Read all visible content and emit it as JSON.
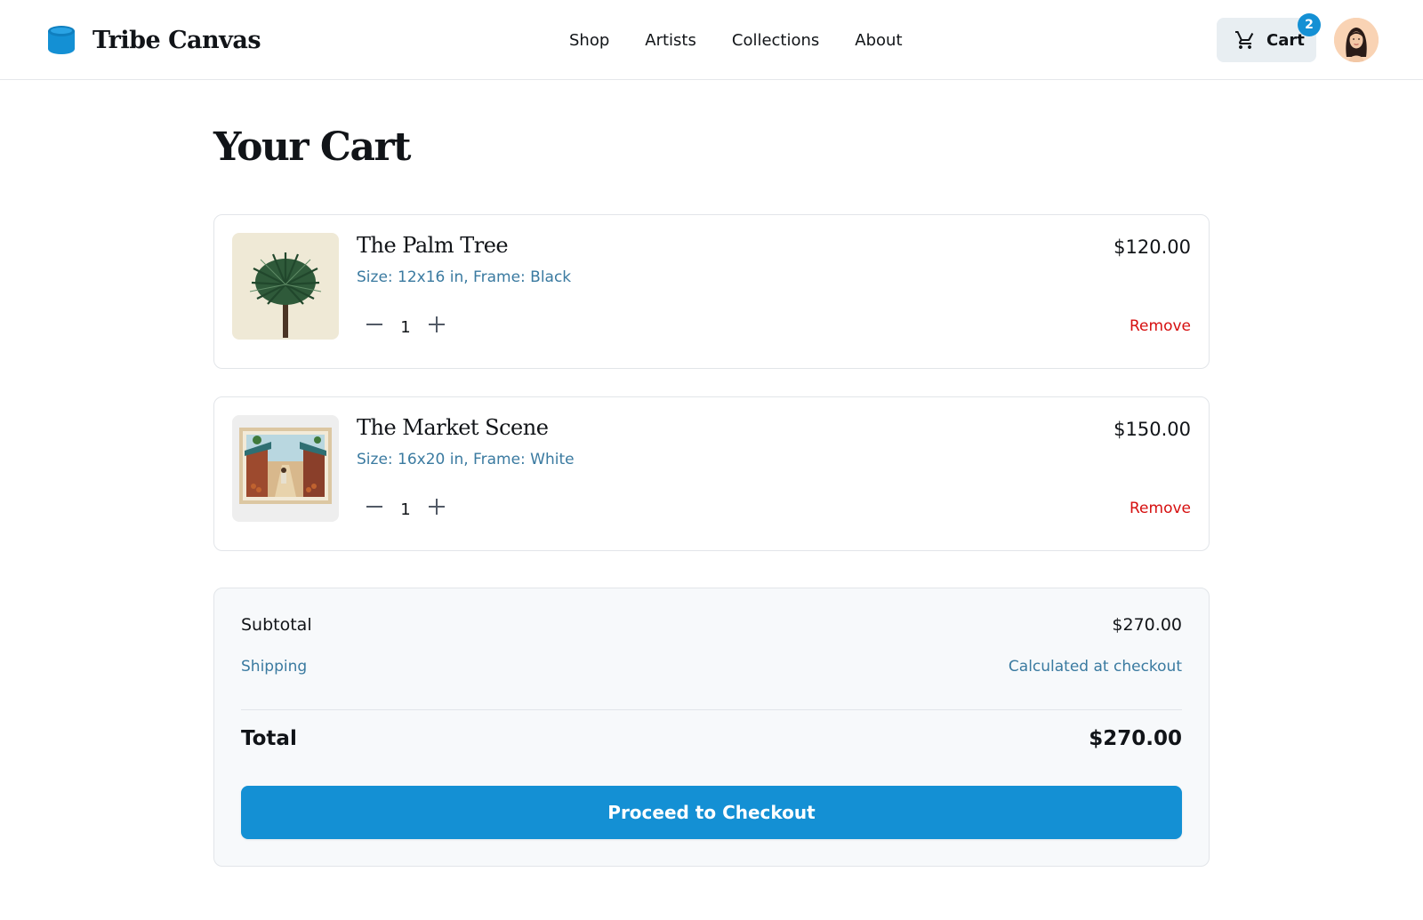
{
  "brand": {
    "name": "Tribe Canvas",
    "icon": "drum-icon",
    "color": "#1490d4"
  },
  "nav": {
    "links": [
      "Shop",
      "Artists",
      "Collections",
      "About"
    ]
  },
  "cart": {
    "label": "Cart",
    "count": "2",
    "icon": "shopping-cart-icon"
  },
  "avatar": {
    "icon": "user-avatar"
  },
  "page": {
    "title": "Your Cart"
  },
  "items": [
    {
      "title": "The Palm Tree",
      "meta": "Size: 12x16 in, Frame: Black",
      "quantity": "1",
      "price": "$120.00",
      "remove_label": "Remove",
      "image": "palm-tree-artwork"
    },
    {
      "title": "The Market Scene",
      "meta": "Size: 16x20 in, Frame: White",
      "quantity": "1",
      "price": "$150.00",
      "remove_label": "Remove",
      "image": "market-scene-artwork"
    }
  ],
  "summary": {
    "subtotal_label": "Subtotal",
    "subtotal_value": "$270.00",
    "shipping_label": "Shipping",
    "shipping_value": "Calculated at checkout",
    "total_label": "Total",
    "total_value": "$270.00",
    "checkout_label": "Proceed to Checkout"
  },
  "colors": {
    "accent": "#1490d4",
    "remove": "#d60f0f",
    "muted_text": "#3a7aa0"
  }
}
